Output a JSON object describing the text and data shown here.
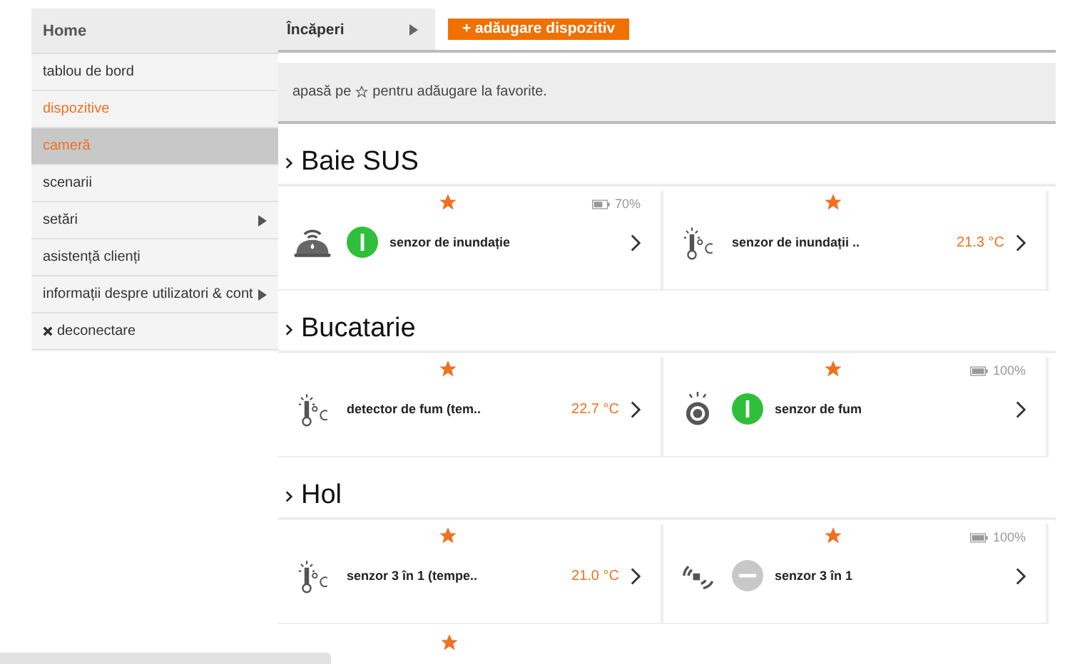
{
  "sidebar": {
    "header": "Home",
    "items": [
      {
        "kind": "link",
        "label": "tablou de bord",
        "selected": false,
        "highlighted": false,
        "submenu": false
      },
      {
        "kind": "link",
        "label": "dispozitive",
        "selected": true,
        "highlighted": false,
        "submenu": false
      },
      {
        "kind": "link",
        "label": "cameră",
        "selected": true,
        "highlighted": true,
        "submenu": false
      },
      {
        "kind": "link",
        "label": "scenarii",
        "selected": false,
        "highlighted": false,
        "submenu": false
      },
      {
        "kind": "link",
        "label": "setări",
        "selected": false,
        "highlighted": false,
        "submenu": true
      },
      {
        "kind": "link",
        "label": "asistență clienți",
        "selected": false,
        "highlighted": false,
        "submenu": false
      },
      {
        "kind": "link",
        "label": "informații despre utilizatori & cont",
        "selected": false,
        "highlighted": false,
        "submenu": true
      },
      {
        "kind": "logout",
        "label": "deconectare",
        "selected": false,
        "highlighted": false,
        "submenu": false
      }
    ]
  },
  "toolbar": {
    "rooms_menu": "Încăperi",
    "add_button": "+ adăugare dispozitiv"
  },
  "hint": {
    "before": "apasă pe",
    "after": "pentru adăugare la favorite."
  },
  "rooms": [
    {
      "name": "Baie SUS",
      "devices": [
        {
          "kind": "water",
          "name": "senzor de inundație",
          "on": true,
          "battery": {
            "label": "70%",
            "level": 0.7
          },
          "favorite": true
        },
        {
          "kind": "thermo",
          "name": "senzor de inundații ..",
          "reading": "21.3 °C",
          "favorite": true
        }
      ]
    },
    {
      "name": "Bucatarie",
      "devices": [
        {
          "kind": "thermo",
          "name": "detector de fum (tem..",
          "reading": "22.7 °C",
          "favorite": true
        },
        {
          "kind": "smoke",
          "name": "senzor de fum",
          "on": true,
          "battery": {
            "label": "100%",
            "level": 1
          },
          "favorite": true
        }
      ]
    },
    {
      "name": "Hol",
      "devices": [
        {
          "kind": "thermo",
          "name": "senzor 3 în 1 (tempe..",
          "reading": "21.0 °C",
          "favorite": true
        },
        {
          "kind": "motion",
          "name": "senzor 3 în 1",
          "on": false,
          "battery": {
            "label": "100%",
            "level": 1
          },
          "favorite": true
        }
      ]
    }
  ],
  "partial_row": {
    "favorite": true
  }
}
